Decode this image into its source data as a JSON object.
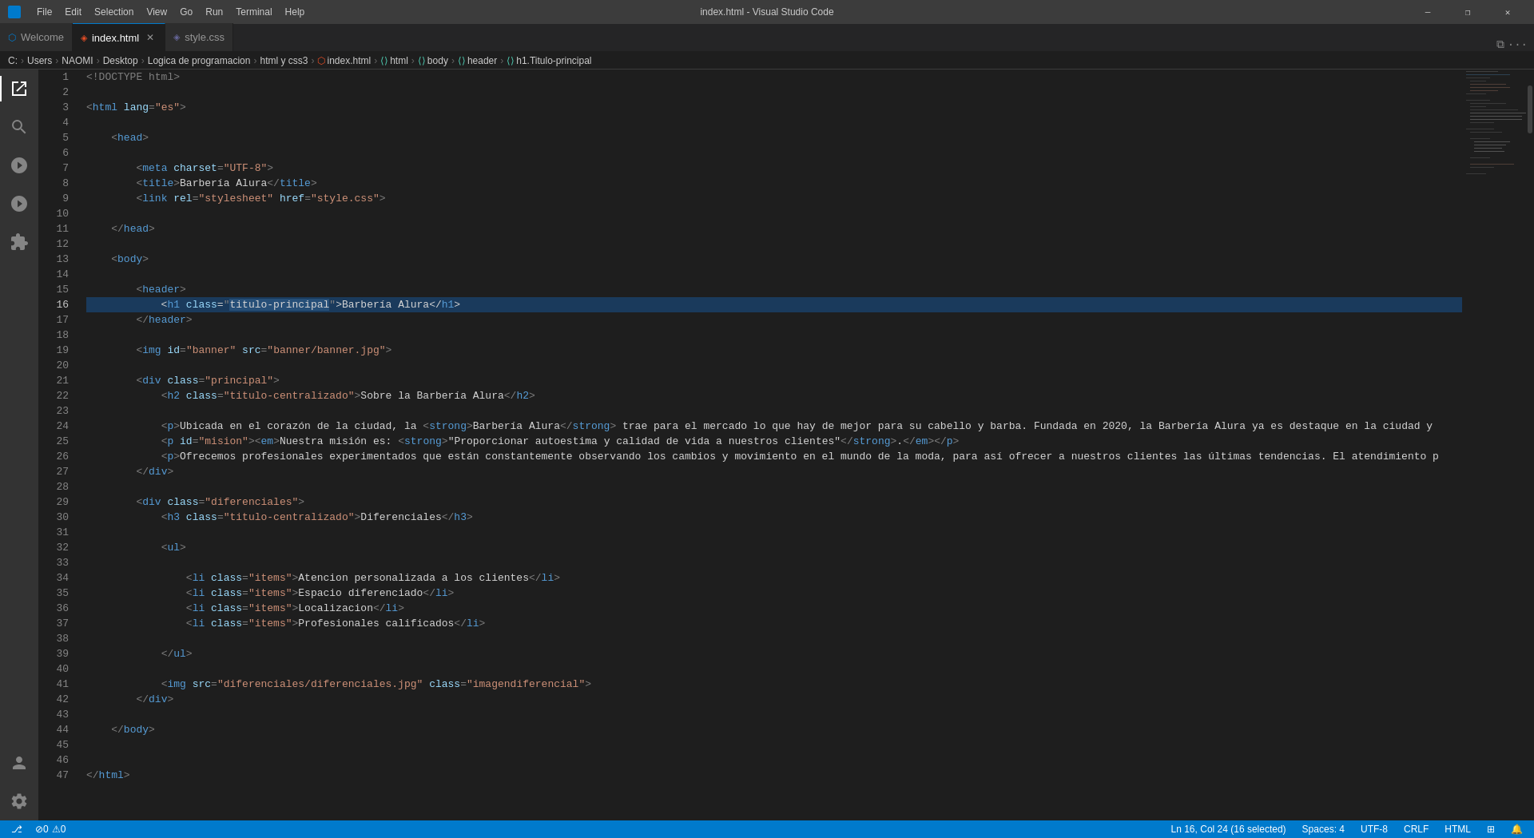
{
  "titlebar": {
    "title": "index.html - Visual Studio Code",
    "menu_items": [
      "File",
      "Edit",
      "Selection",
      "View",
      "Go",
      "Run",
      "Terminal",
      "Help"
    ],
    "btn_minimize": "—",
    "btn_restore": "❐",
    "btn_close": "✕"
  },
  "tabs": [
    {
      "id": "welcome",
      "label": "Welcome",
      "icon": "welcome",
      "active": false,
      "modified": false
    },
    {
      "id": "index",
      "label": "index.html",
      "icon": "html",
      "active": true,
      "modified": false
    },
    {
      "id": "style",
      "label": "style.css",
      "icon": "css",
      "active": false,
      "modified": false
    }
  ],
  "breadcrumb": {
    "parts": [
      "C:",
      "Users",
      "NAOMI",
      "Desktop",
      "Logica de programacion",
      "html y css3",
      "index.html",
      "html",
      "body",
      "header",
      "h1.Titulo-principal"
    ]
  },
  "activitybar": {
    "items": [
      {
        "id": "explorer",
        "icon": "📋",
        "active": true
      },
      {
        "id": "search",
        "icon": "🔍",
        "active": false
      },
      {
        "id": "git",
        "icon": "⎇",
        "active": false
      },
      {
        "id": "debug",
        "icon": "▷",
        "active": false
      },
      {
        "id": "extensions",
        "icon": "⊞",
        "active": false
      }
    ],
    "bottom": [
      {
        "id": "account",
        "icon": "👤"
      },
      {
        "id": "settings",
        "icon": "⚙"
      }
    ]
  },
  "code": {
    "lines": [
      {
        "num": 1,
        "content": "<!DOCTYPE html>"
      },
      {
        "num": 2,
        "content": ""
      },
      {
        "num": 3,
        "content": "<html lang=\"es\">"
      },
      {
        "num": 4,
        "content": ""
      },
      {
        "num": 5,
        "content": "    <head>"
      },
      {
        "num": 6,
        "content": ""
      },
      {
        "num": 7,
        "content": "        <meta charset=\"UTF-8\">"
      },
      {
        "num": 8,
        "content": "        <title>Barbería Alura</title>"
      },
      {
        "num": 9,
        "content": "        <link rel=\"stylesheet\" href=\"style.css\">"
      },
      {
        "num": 10,
        "content": ""
      },
      {
        "num": 11,
        "content": "    </head>"
      },
      {
        "num": 12,
        "content": ""
      },
      {
        "num": 13,
        "content": "    <body>"
      },
      {
        "num": 14,
        "content": ""
      },
      {
        "num": 15,
        "content": "        <header>"
      },
      {
        "num": 16,
        "content": "            <h1 class=\"titulo-principal\">Barbería Alura</h1>",
        "selected": true
      },
      {
        "num": 17,
        "content": "        </header>"
      },
      {
        "num": 18,
        "content": ""
      },
      {
        "num": 19,
        "content": "        <img id=\"banner\" src=\"banner/banner.jpg\">"
      },
      {
        "num": 20,
        "content": ""
      },
      {
        "num": 21,
        "content": "        <div class=\"principal\">"
      },
      {
        "num": 22,
        "content": "            <h2 class=\"titulo-centralizado\">Sobre la Barbería Alura</h2>"
      },
      {
        "num": 23,
        "content": ""
      },
      {
        "num": 24,
        "content": "            <p>Ubicada en el corazón de la ciudad, la <strong>Barbería Alura</strong> trae para el mercado lo que hay de mejor para su cabello y barba. Fundada en 2020, la Barbería Alura ya es destaque en la ciudad y"
      },
      {
        "num": 25,
        "content": "            <p id=\"mision\"><em>Nuestra misión es: <strong>\"Proporcionar autoestima y calidad de vida a nuestros clientes\"</strong>.</em></p>"
      },
      {
        "num": 26,
        "content": "            <p>Ofrecemos profesionales experimentados que están constantemente observando los cambios y movimiento en el mundo de la moda, para así ofrecer a nuestros clientes las últimas tendencias. El atendimiento p"
      },
      {
        "num": 27,
        "content": "        </div>"
      },
      {
        "num": 28,
        "content": ""
      },
      {
        "num": 29,
        "content": "        <div class=\"diferenciales\">"
      },
      {
        "num": 30,
        "content": "            <h3 class=\"titulo-centralizado\">Diferenciales</h3>"
      },
      {
        "num": 31,
        "content": ""
      },
      {
        "num": 32,
        "content": "            <ul>"
      },
      {
        "num": 33,
        "content": ""
      },
      {
        "num": 34,
        "content": "                <li class=\"items\">Atencion personalizada a los clientes</li>"
      },
      {
        "num": 35,
        "content": "                <li class=\"items\">Espacio diferenciado</li>"
      },
      {
        "num": 36,
        "content": "                <li class=\"items\">Localizacion</li>"
      },
      {
        "num": 37,
        "content": "                <li class=\"items\">Profesionales calificados</li>"
      },
      {
        "num": 38,
        "content": ""
      },
      {
        "num": 39,
        "content": "            </ul>"
      },
      {
        "num": 40,
        "content": ""
      },
      {
        "num": 41,
        "content": "            <img src=\"diferenciales/diferenciales.jpg\" class=\"imagendiferencial\">"
      },
      {
        "num": 42,
        "content": "        </div>"
      },
      {
        "num": 43,
        "content": ""
      },
      {
        "num": 44,
        "content": "    </body>"
      },
      {
        "num": 45,
        "content": ""
      },
      {
        "num": 46,
        "content": ""
      },
      {
        "num": 47,
        "content": "</html>"
      }
    ]
  },
  "statusbar": {
    "left": {
      "errors": "0",
      "warnings": "0"
    },
    "right": {
      "position": "Ln 16, Col 24 (16 selected)",
      "spaces": "Spaces: 4",
      "encoding": "UTF-8",
      "line_ending": "CRLF",
      "language": "HTML"
    }
  }
}
